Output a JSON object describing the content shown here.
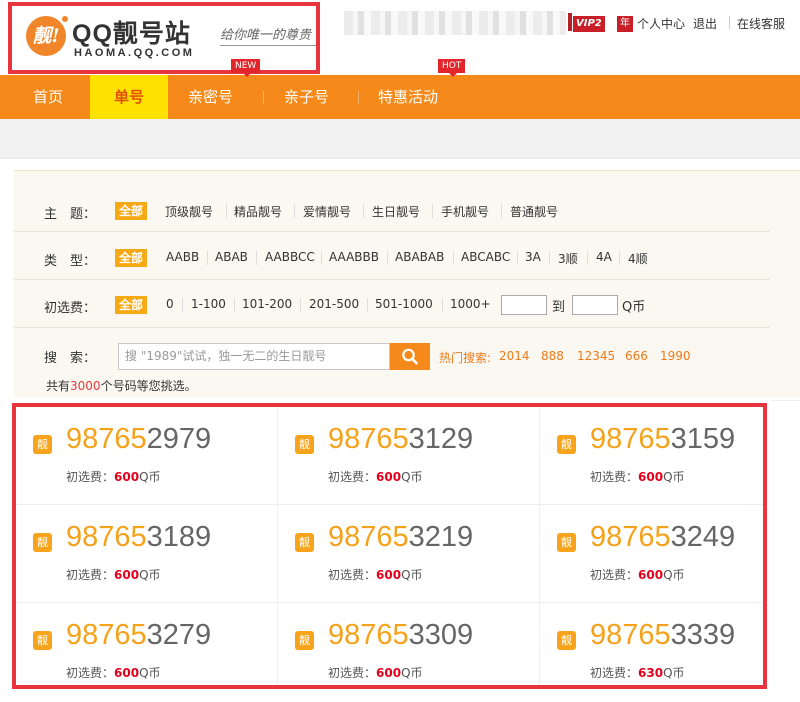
{
  "header": {
    "logo_badge": "靓!",
    "logo_title": "QQ靓号站",
    "logo_domain": "HAOMA.QQ.COM",
    "logo_slogan": "给你唯一的尊贵",
    "vip_badge": "VIP2",
    "year_badge": "年",
    "links": [
      "个人中心",
      "退出",
      "在线客服"
    ]
  },
  "nav": {
    "items": [
      "首页",
      "单号",
      "亲密号",
      "亲子号",
      "特惠活动"
    ],
    "active_index": 1,
    "tags": {
      "new": "NEW",
      "hot": "HOT"
    }
  },
  "filters": {
    "theme": {
      "label": "主　题：",
      "options": [
        "全部",
        "顶级靓号",
        "精品靓号",
        "爱情靓号",
        "生日靓号",
        "手机靓号",
        "普通靓号"
      ]
    },
    "type": {
      "label": "类　型：",
      "options": [
        "全部",
        "AABB",
        "ABAB",
        "AABBCC",
        "AAABBB",
        "ABABAB",
        "ABCABC",
        "3A",
        "3顺",
        "4A",
        "4顺"
      ]
    },
    "fee": {
      "label": "初选费：",
      "options": [
        "全部",
        "0",
        "1-100",
        "101-200",
        "201-500",
        "501-1000",
        "1000+"
      ],
      "to_label": "到",
      "unit": "Q币",
      "min_value": "",
      "max_value": ""
    },
    "search": {
      "label": "搜　索：",
      "placeholder": "搜 \"1989\"试试，独一无二的生日靓号"
    },
    "hot_search": {
      "label": "热门搜索:",
      "keywords": [
        "2014",
        "888",
        "12345",
        "666",
        "1990"
      ]
    },
    "count": {
      "prefix": "共有",
      "value": "3000",
      "suffix": "个号码等您挑选。"
    }
  },
  "numbers": [
    {
      "icon": "靓",
      "prefix": "98765",
      "suffix": "2979",
      "price_label": "初选费：",
      "price": "600",
      "unit": "Q币"
    },
    {
      "icon": "靓",
      "prefix": "98765",
      "suffix": "3129",
      "price_label": "初选费：",
      "price": "600",
      "unit": "Q币"
    },
    {
      "icon": "靓",
      "prefix": "98765",
      "suffix": "3159",
      "price_label": "初选费：",
      "price": "600",
      "unit": "Q币"
    },
    {
      "icon": "靓",
      "prefix": "98765",
      "suffix": "3189",
      "price_label": "初选费：",
      "price": "600",
      "unit": "Q币"
    },
    {
      "icon": "靓",
      "prefix": "98765",
      "suffix": "3219",
      "price_label": "初选费：",
      "price": "600",
      "unit": "Q币"
    },
    {
      "icon": "靓",
      "prefix": "98765",
      "suffix": "3249",
      "price_label": "初选费：",
      "price": "600",
      "unit": "Q币"
    },
    {
      "icon": "靓",
      "prefix": "98765",
      "suffix": "3279",
      "price_label": "初选费：",
      "price": "600",
      "unit": "Q币"
    },
    {
      "icon": "靓",
      "prefix": "98765",
      "suffix": "3309",
      "price_label": "初选费：",
      "price": "600",
      "unit": "Q币"
    },
    {
      "icon": "靓",
      "prefix": "98765",
      "suffix": "3339",
      "price_label": "初选费：",
      "price": "630",
      "unit": "Q币"
    }
  ],
  "colors": {
    "nav_orange": "#f58a1b",
    "active_yellow": "#ffe100",
    "highlight_red": "#e8343c",
    "price_red": "#e4001a",
    "number_orange": "#f5a21b"
  }
}
